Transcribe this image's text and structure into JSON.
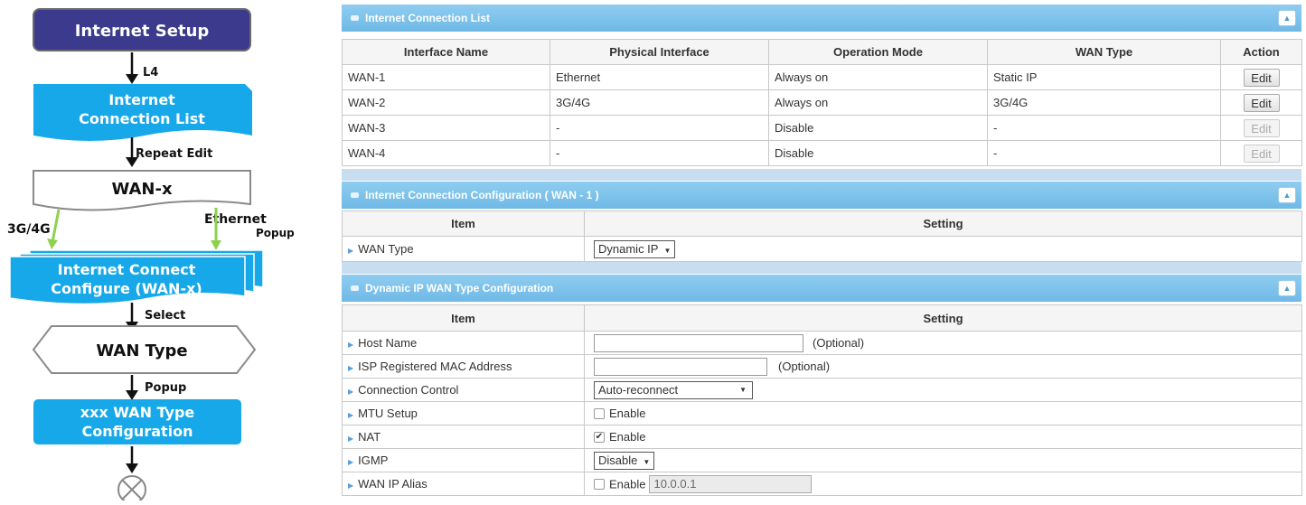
{
  "flowchart": {
    "internet_setup": "Internet Setup",
    "l4": "L4",
    "conn_list_line1": "Internet",
    "conn_list_line2": "Connection List",
    "repeat_edit": "Repeat Edit",
    "wan_x": "WAN-x",
    "branch_3g4g": "3G/4G",
    "branch_ethernet": "Ethernet",
    "popup_1": "Popup",
    "configure_line1": "Internet Connect",
    "configure_line2": "Configure (WAN-x)",
    "select": "Select",
    "wan_type": "WAN Type",
    "popup_2": "Popup",
    "xxx_line1": "xxx  WAN Type",
    "xxx_line2": "Configuration",
    "colors": {
      "dark_box": "#3b3a8c",
      "blue_box": "#16a8e8",
      "arrow_green": "#8fd14f"
    }
  },
  "connection_list": {
    "title": "Internet Connection List",
    "headers": [
      "Interface Name",
      "Physical Interface",
      "Operation Mode",
      "WAN Type",
      "Action"
    ],
    "rows": [
      {
        "name": "WAN-1",
        "physical": "Ethernet",
        "mode": "Always on",
        "wan_type": "Static IP",
        "action": "Edit",
        "enabled": true
      },
      {
        "name": "WAN-2",
        "physical": "3G/4G",
        "mode": "Always on",
        "wan_type": "3G/4G",
        "action": "Edit",
        "enabled": true
      },
      {
        "name": "WAN-3",
        "physical": "-",
        "mode": "Disable",
        "wan_type": "-",
        "action": "Edit",
        "enabled": false
      },
      {
        "name": "WAN-4",
        "physical": "-",
        "mode": "Disable",
        "wan_type": "-",
        "action": "Edit",
        "enabled": false
      }
    ]
  },
  "connection_config": {
    "title": "Internet Connection Configuration ( WAN - 1 )",
    "headers": [
      "Item",
      "Setting"
    ],
    "wan_type_label": "WAN Type",
    "wan_type_value": "Dynamic IP"
  },
  "dynamic_ip": {
    "title": "Dynamic IP WAN Type Configuration",
    "headers": [
      "Item",
      "Setting"
    ],
    "host_name_label": "Host Name",
    "host_name_value": "",
    "host_name_hint": "(Optional)",
    "mac_label": "ISP Registered MAC Address",
    "mac_value": "",
    "mac_hint": "(Optional)",
    "conn_control_label": "Connection Control",
    "conn_control_value": "Auto-reconnect",
    "mtu_label": "MTU Setup",
    "mtu_enable": "Enable",
    "mtu_checked": false,
    "nat_label": "NAT",
    "nat_enable": "Enable",
    "nat_checked": true,
    "igmp_label": "IGMP",
    "igmp_value": "Disable",
    "alias_label": "WAN IP Alias",
    "alias_enable": "Enable",
    "alias_checked": false,
    "alias_value": "10.0.0.1"
  },
  "icons": {
    "bullet": "arrow-right-icon",
    "collapse": "chevron-up-icon",
    "checkmark": "✔"
  }
}
